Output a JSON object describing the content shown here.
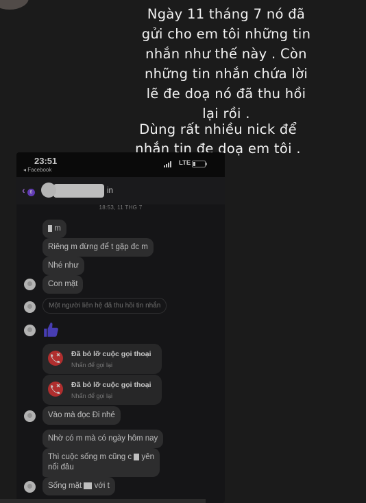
{
  "caption": {
    "paragraph1": "Ngày 11 tháng 7 nó đã\ngửi cho em tôi những tin\nnhắn như thế này . Còn\nnhững tin nhắn chứa lời\nlẽ đe doạ nó đã thu hồi\nlại rồi .",
    "paragraph2": "Dùng rất nhiều nick để\nnhắn tin đe doạ em tôi ."
  },
  "status_bar": {
    "time": "23:51",
    "back_app": "◂ Facebook",
    "network": "LTE"
  },
  "chat_header": {
    "back_badge": "6",
    "name_suffix": "in"
  },
  "timestamp": "18:53, 11 THG 7",
  "messages": [
    {
      "pre": "",
      "post": "m"
    },
    {
      "text": "Riêng m đừng để t gặp đc m"
    },
    {
      "text": "Nhé như"
    },
    {
      "text": "Con mặt"
    },
    {
      "text": "Một người liên hệ đã thu hồi tin nhắn"
    },
    {
      "text": "Vào mà đọc Đi nhé"
    },
    {
      "text": "Nhờ có m mà có ngày hôm nay"
    },
    {
      "pre": "Thì cuộc sống m cũng c",
      "post": "yên"
    },
    {
      "text": "nổi đâu"
    },
    {
      "pre": "Sống mặt",
      "post": "với t"
    }
  ],
  "calls": [
    {
      "title": "Đã bỏ lỡ cuộc gọi thoại",
      "subtitle": "Nhấn để gọi lại"
    },
    {
      "title": "Đã bỏ lỡ cuộc gọi thoại",
      "subtitle": "Nhấn để gọi lại"
    }
  ],
  "colors": {
    "accent": "#7d4ce8",
    "like": "#5b4fe6",
    "missed_call": "#e23b3b"
  },
  "icons": {
    "like": "thumbs-up-icon",
    "call": "missed-call-icon"
  }
}
